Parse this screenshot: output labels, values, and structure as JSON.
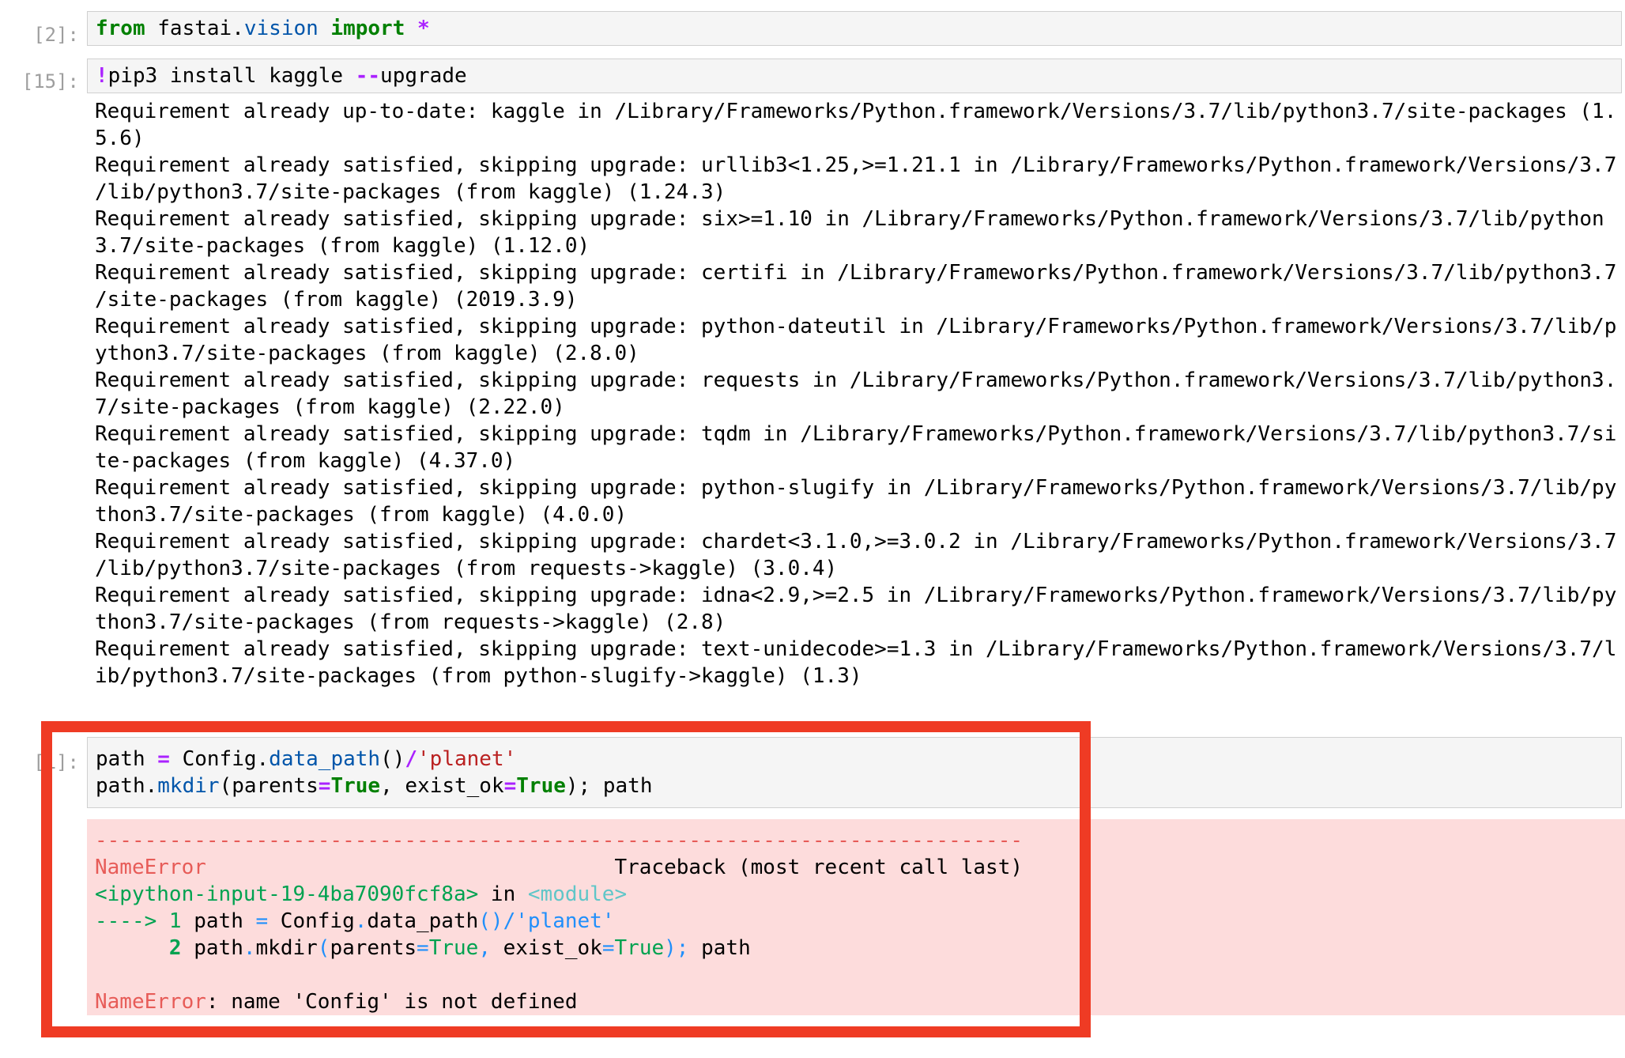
{
  "cells": [
    {
      "prompt": "[2]:",
      "code_tokens": {
        "kw_from": "from",
        "module": " fastai.",
        "submodule": "vision",
        "kw_import": " import",
        "star": " *"
      }
    },
    {
      "prompt": "[15]:",
      "code_tokens": {
        "bang": "!",
        "cmd": "pip3 install kaggle ",
        "flag": "--",
        "flag_rest": "upgrade"
      },
      "output_lines": [
        "Requirement already up-to-date: kaggle in /Library/Frameworks/Python.framework/Versions/3.7/lib/python3.7/site-packages (1.",
        "5.6)",
        "Requirement already satisfied, skipping upgrade: urllib3<1.25,>=1.21.1 in /Library/Frameworks/Python.framework/Versions/3.7",
        "/lib/python3.7/site-packages (from kaggle) (1.24.3)",
        "Requirement already satisfied, skipping upgrade: six>=1.10 in /Library/Frameworks/Python.framework/Versions/3.7/lib/python",
        "3.7/site-packages (from kaggle) (1.12.0)",
        "Requirement already satisfied, skipping upgrade: certifi in /Library/Frameworks/Python.framework/Versions/3.7/lib/python3.7",
        "/site-packages (from kaggle) (2019.3.9)",
        "Requirement already satisfied, skipping upgrade: python-dateutil in /Library/Frameworks/Python.framework/Versions/3.7/lib/p",
        "ython3.7/site-packages (from kaggle) (2.8.0)",
        "Requirement already satisfied, skipping upgrade: requests in /Library/Frameworks/Python.framework/Versions/3.7/lib/python3.",
        "7/site-packages (from kaggle) (2.22.0)",
        "Requirement already satisfied, skipping upgrade: tqdm in /Library/Frameworks/Python.framework/Versions/3.7/lib/python3.7/si",
        "te-packages (from kaggle) (4.37.0)",
        "Requirement already satisfied, skipping upgrade: python-slugify in /Library/Frameworks/Python.framework/Versions/3.7/lib/py",
        "thon3.7/site-packages (from kaggle) (4.0.0)",
        "Requirement already satisfied, skipping upgrade: chardet<3.1.0,>=3.0.2 in /Library/Frameworks/Python.framework/Versions/3.7",
        "/lib/python3.7/site-packages (from requests->kaggle) (3.0.4)",
        "Requirement already satisfied, skipping upgrade: idna<2.9,>=2.5 in /Library/Frameworks/Python.framework/Versions/3.7/lib/py",
        "thon3.7/site-packages (from requests->kaggle) (2.8)",
        "Requirement already satisfied, skipping upgrade: text-unidecode>=1.3 in /Library/Frameworks/Python.framework/Versions/3.7/l",
        "ib/python3.7/site-packages (from python-slugify->kaggle) (1.3)"
      ]
    },
    {
      "prompt": "[1",
      "prompt_tail": "]:",
      "line1": {
        "a": "path ",
        "eq": "=",
        "b": " Config.",
        "call": "data_path",
        "c": "()",
        "slash": "/",
        "str": "'planet'"
      },
      "line2": {
        "a": "path.",
        "call": "mkdir",
        "b": "(parents",
        "eq1": "=",
        "true1": "True",
        "c": ", exist_ok",
        "eq2": "=",
        "true2": "True",
        "d": "); path"
      },
      "error": {
        "dashes": "---------------------------------------------------------------------------",
        "name": "NameError",
        "spacer": "                                 ",
        "traceback": "Traceback (most recent call last)",
        "input_ref": "<ipython-input-19-4ba7090fcf8a>",
        "in_word": " in ",
        "module_ref": "<module>",
        "arrow": "----> 1",
        "tb1_a": " path ",
        "tb1_eq": "=",
        "tb1_b": " Config",
        "tb1_dot": ".",
        "tb1_c": "data_path",
        "tb1_paren": "()/",
        "tb1_str": "'planet'",
        "indent2": "      ",
        "num2": "2",
        "tb2_a": " path",
        "tb2_dot": ".",
        "tb2_b": "mkdir",
        "tb2_paren": "(",
        "tb2_c": "parents",
        "tb2_eq1": "=",
        "tb2_true1": "True",
        "tb2_comma": ", ",
        "tb2_d": "exist_ok",
        "tb2_eq2": "=",
        "tb2_true2": "True",
        "tb2_end": ");",
        "tb2_tail": " path",
        "final_name": "NameError",
        "final_msg": ": name 'Config' is not defined"
      }
    }
  ],
  "colors": {
    "highlight_border": "#ef3b24",
    "error_background": "#fddcdc",
    "input_background": "#f5f5f5"
  }
}
